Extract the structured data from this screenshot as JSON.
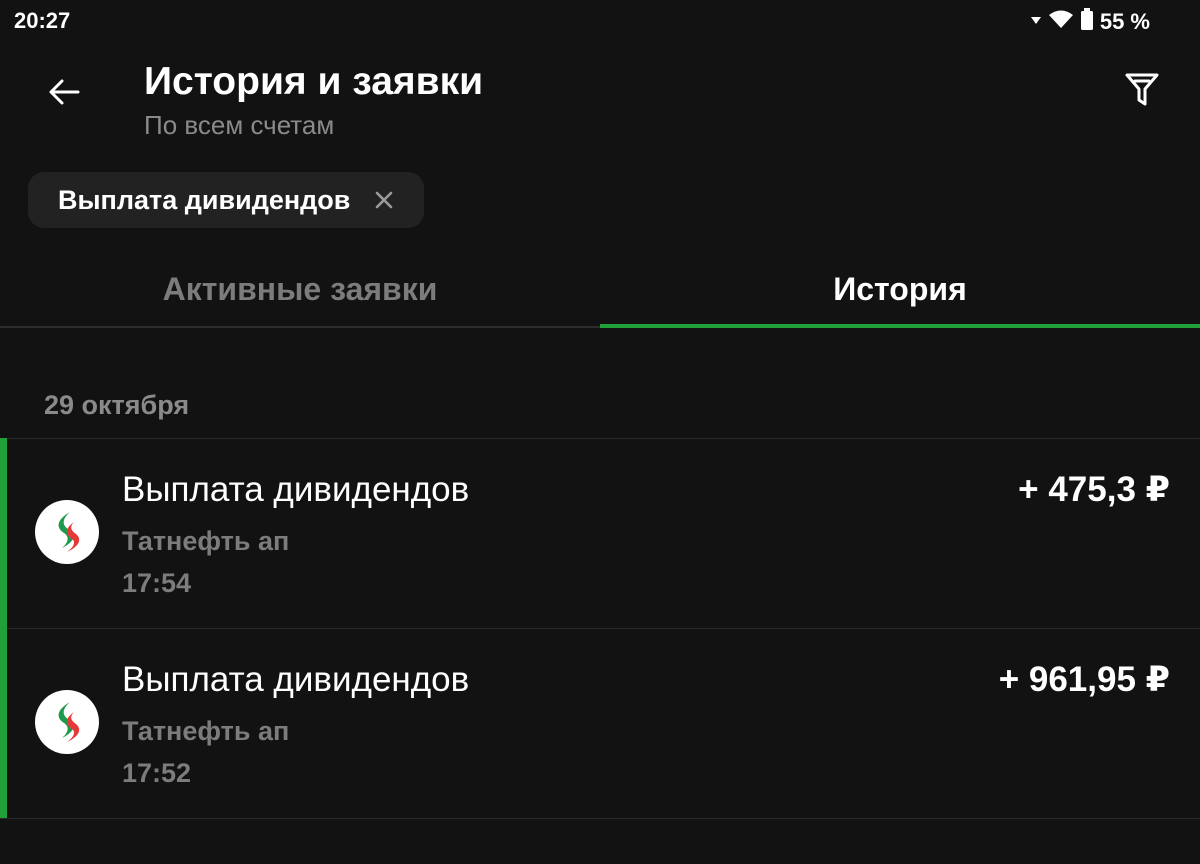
{
  "status_bar": {
    "time": "20:27",
    "battery": "55 %",
    "icons": [
      "signal-icon",
      "wifi-icon",
      "battery-icon"
    ]
  },
  "header": {
    "title": "История и заявки",
    "subtitle": "По всем счетам",
    "back_icon": "arrow-left-icon",
    "filter_icon": "filter-icon"
  },
  "filter_chip": {
    "label": "Выплата дивидендов",
    "close_icon": "close-icon"
  },
  "tabs": [
    {
      "label": "Активные заявки",
      "active": false
    },
    {
      "label": "История",
      "active": true
    }
  ],
  "accent_color": "#21a038",
  "history": {
    "date": "29 октября",
    "operations": [
      {
        "title": "Выплата дивидендов",
        "company": "Татнефть ап",
        "time": "17:54",
        "amount": "+ 475,3 ₽",
        "logo": "tatneft-logo"
      },
      {
        "title": "Выплата дивидендов",
        "company": "Татнефть ап",
        "time": "17:52",
        "amount": "+ 961,95 ₽",
        "logo": "tatneft-logo"
      }
    ]
  }
}
